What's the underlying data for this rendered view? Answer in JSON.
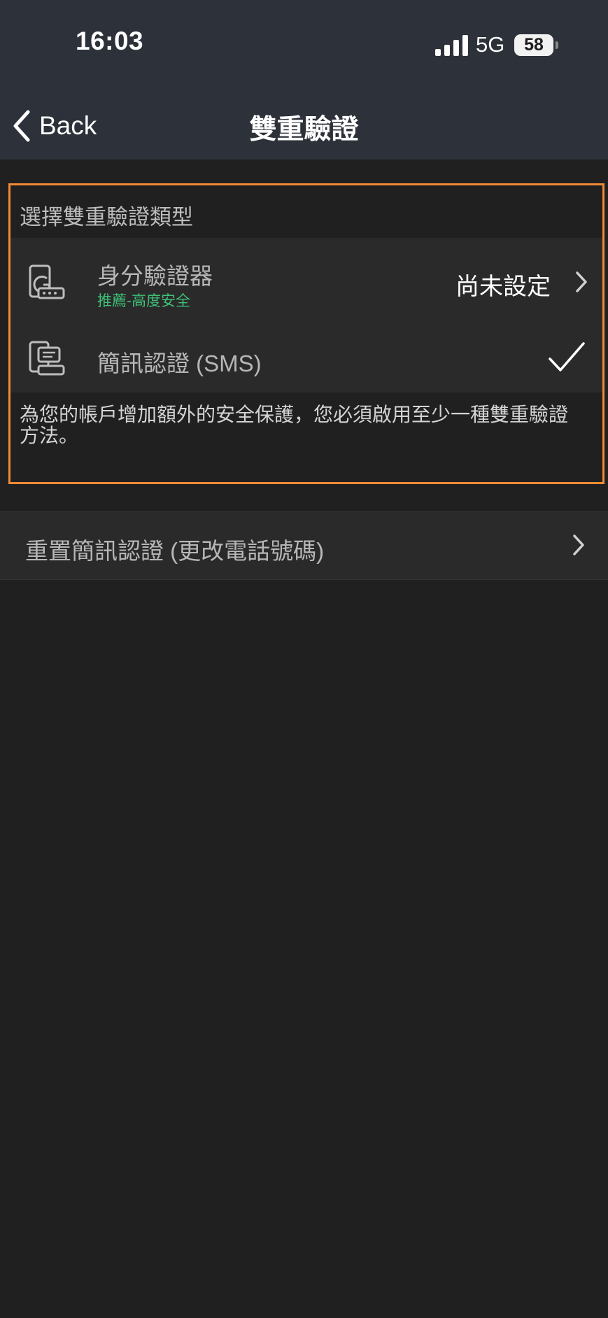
{
  "status_bar": {
    "time": "16:03",
    "network": "5G",
    "battery": "58"
  },
  "nav": {
    "back_label": "Back",
    "title": "雙重驗證"
  },
  "section": {
    "header": "選擇雙重驗證類型",
    "options": [
      {
        "label": "身分驗證器",
        "sublabel": "推薦-高度安全",
        "value": "尚未設定",
        "icon": "authenticator-phone-icon"
      },
      {
        "label": "簡訊認證 (SMS)",
        "selected": true,
        "icon": "sms-phone-icon"
      }
    ],
    "footer": "為您的帳戶增加額外的安全保護，您必須啟用至少一種雙重驗證方法。"
  },
  "reset": {
    "label": "重置簡訊認證 (更改電話號碼)"
  },
  "colors": {
    "highlight": "#ef8a36",
    "recommend": "#3fbf77",
    "background": "#202020",
    "header": "#2d3139"
  }
}
